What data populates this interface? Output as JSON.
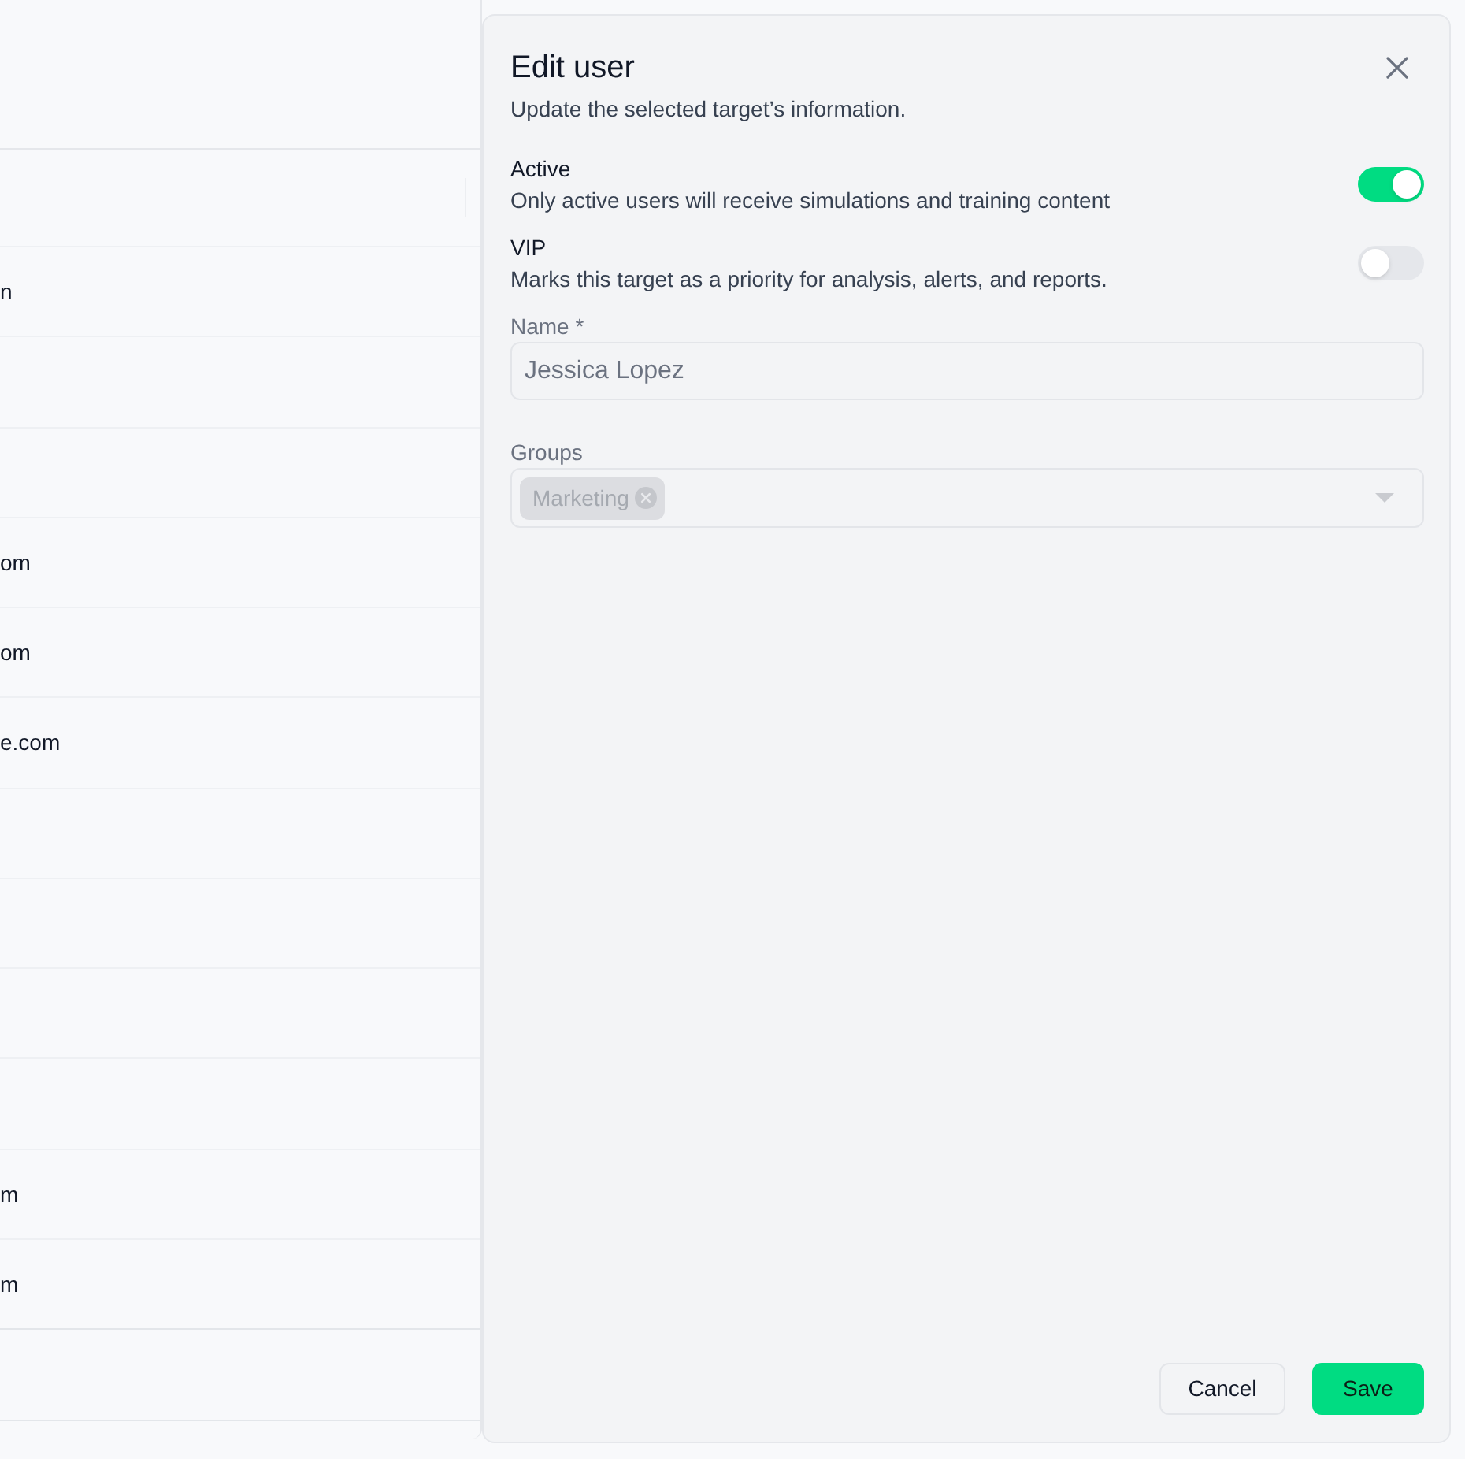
{
  "table": {
    "rows": [
      {
        "column_1": "n"
      },
      {},
      {},
      {
        "column_1": "om"
      },
      {
        "column_1": "om"
      },
      {
        "column_1": "e.com"
      },
      {},
      {},
      {},
      {},
      {
        "column_1": "m"
      },
      {
        "column_1": "m"
      }
    ]
  },
  "drawer": {
    "title": "Edit user",
    "subtitle": "Update the selected target’s information.",
    "toggles": [
      {
        "label": "Active",
        "description": "Only active users will receive simulations and training content",
        "on": true
      },
      {
        "label": "VIP",
        "description": "Marks this target as a priority for analysis, alerts, and reports.",
        "on": false
      }
    ],
    "name_field": {
      "label": "Name *",
      "value": "Jessica Lopez",
      "disabled": true
    },
    "groups_field": {
      "label": "Groups",
      "disabled": true,
      "chips": [
        {
          "label": "Marketing"
        }
      ]
    },
    "buttons": [
      {
        "label": "Cancel",
        "kind": "secondary"
      },
      {
        "label": "Save",
        "kind": "primary"
      }
    ]
  }
}
